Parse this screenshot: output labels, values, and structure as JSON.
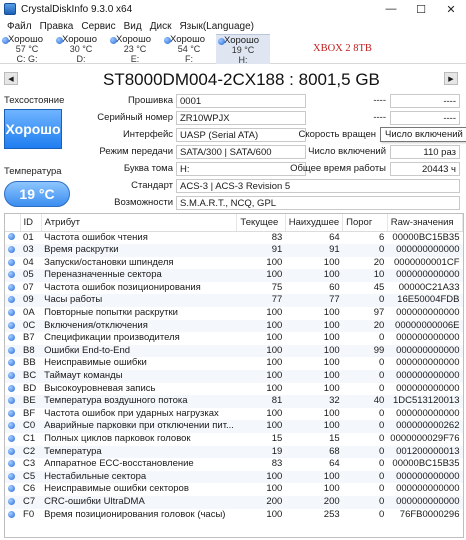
{
  "window": {
    "title": "CrystalDiskInfo 9.3.0 x64"
  },
  "menu": [
    "Файл",
    "Правка",
    "Сервис",
    "Вид",
    "Диск",
    "Язык(Language)"
  ],
  "drives": [
    {
      "status": "Хорошо",
      "temp": "57 °C",
      "letter": "C: G:"
    },
    {
      "status": "Хорошо",
      "temp": "30 °C",
      "letter": "D:"
    },
    {
      "status": "Хорошо",
      "temp": "23 °C",
      "letter": "E:"
    },
    {
      "status": "Хорошо",
      "temp": "54 °C",
      "letter": "F:"
    },
    {
      "status": "Хорошо",
      "temp": "19 °C",
      "letter": "H:"
    }
  ],
  "drive_label": "XBOX 2 8TB",
  "model": "ST8000DM004-2CX188 : 8001,5 GB",
  "health": {
    "label": "Техсостояние",
    "value": "Хорошо"
  },
  "temperature": {
    "label": "Температура",
    "value": "19 °C"
  },
  "info": {
    "firmware_label": "Прошивка",
    "firmware": "0001",
    "serial_label": "Серийный номер",
    "serial": "ZR10WPJX",
    "interface_label": "Интерфейс",
    "interface": "UASP (Serial ATA)",
    "mode_label": "Режим передачи",
    "mode": "SATA/300 | SATA/600",
    "letter_label": "Буква тома",
    "letter": "H:",
    "standard_label": "Стандарт",
    "standard": "ACS-3 | ACS-3 Revision 5",
    "features_label": "Возможности",
    "features": "S.M.A.R.T., NCQ, GPL",
    "r1": "----",
    "r1b": "----",
    "r2": "----",
    "r2b": "----",
    "rotation_label": "Скорость вращен",
    "power_on_count_label": "Число включений",
    "power_on_count": "110 раз",
    "power_on_hours_label": "Общее время работы",
    "power_on_hours": "20443 ч"
  },
  "tooltip": "Число включений",
  "table": {
    "headers": [
      "ID",
      "Атрибут",
      "Текущее",
      "Наихудшее",
      "Порог",
      "Raw-значения"
    ],
    "rows": [
      [
        "01",
        "Частота ошибок чтения",
        "83",
        "64",
        "6",
        "00000BC15B35"
      ],
      [
        "03",
        "Время раскрутки",
        "91",
        "91",
        "0",
        "000000000000"
      ],
      [
        "04",
        "Запуски/остановки шпинделя",
        "100",
        "100",
        "20",
        "0000000001CF"
      ],
      [
        "05",
        "Переназначенные сектора",
        "100",
        "100",
        "10",
        "000000000000"
      ],
      [
        "07",
        "Частота ошибок позиционирования",
        "75",
        "60",
        "45",
        "00000C21A33"
      ],
      [
        "09",
        "Часы работы",
        "77",
        "77",
        "0",
        "16E50004FDB"
      ],
      [
        "0A",
        "Повторные попытки раскрутки",
        "100",
        "100",
        "97",
        "000000000000"
      ],
      [
        "0C",
        "Включения/отключения",
        "100",
        "100",
        "20",
        "00000000006E"
      ],
      [
        "B7",
        "Спецификации производителя",
        "100",
        "100",
        "0",
        "000000000000"
      ],
      [
        "B8",
        "Ошибки End-to-End",
        "100",
        "100",
        "99",
        "000000000000"
      ],
      [
        "BB",
        "Неисправимые ошибки",
        "100",
        "100",
        "0",
        "000000000000"
      ],
      [
        "BC",
        "Таймаут команды",
        "100",
        "100",
        "0",
        "000000000000"
      ],
      [
        "BD",
        "Высокоуровневая запись",
        "100",
        "100",
        "0",
        "000000000000"
      ],
      [
        "BE",
        "Температура воздушного потока",
        "81",
        "32",
        "40",
        "1DC513120013"
      ],
      [
        "BF",
        "Частота ошибок при ударных нагрузках",
        "100",
        "100",
        "0",
        "000000000000"
      ],
      [
        "C0",
        "Аварийные парковки при отключении пит...",
        "100",
        "100",
        "0",
        "000000000262"
      ],
      [
        "C1",
        "Полных циклов парковок головок",
        "15",
        "15",
        "0",
        "0000000029F76"
      ],
      [
        "C2",
        "Температура",
        "19",
        "68",
        "0",
        "001200000013"
      ],
      [
        "C3",
        "Аппаратное ECC-восстановление",
        "83",
        "64",
        "0",
        "00000BC15B35"
      ],
      [
        "C5",
        "Нестабильные сектора",
        "100",
        "100",
        "0",
        "000000000000"
      ],
      [
        "C6",
        "Неисправимые ошибки секторов",
        "100",
        "100",
        "0",
        "000000000000"
      ],
      [
        "C7",
        "CRC-ошибки UltraDMA",
        "200",
        "200",
        "0",
        "000000000000"
      ],
      [
        "F0",
        "Время позиционирования головок (часы)",
        "100",
        "253",
        "0",
        "76FB0000296"
      ]
    ]
  }
}
